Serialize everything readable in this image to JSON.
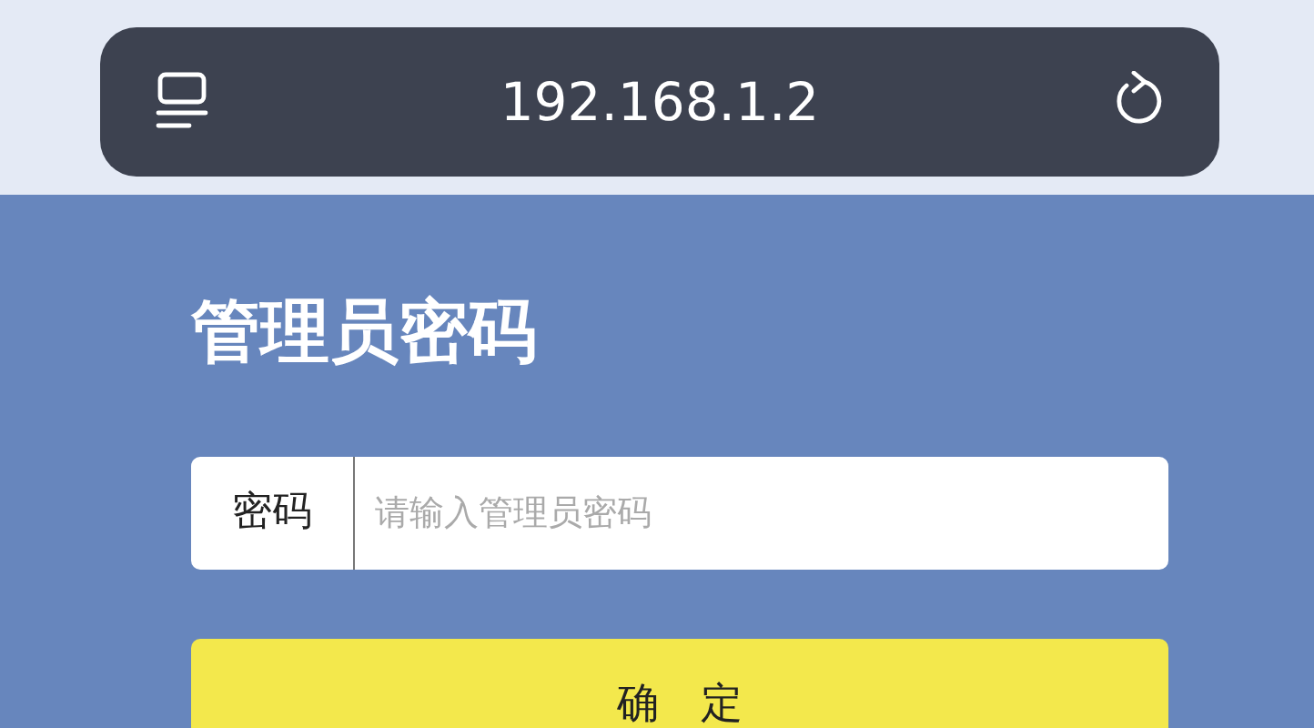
{
  "address_bar": {
    "url": "192.168.1.2"
  },
  "login": {
    "title": "管理员密码",
    "password_field": {
      "label": "密码",
      "placeholder": "请输入管理员密码"
    },
    "submit_button": "确　定"
  }
}
